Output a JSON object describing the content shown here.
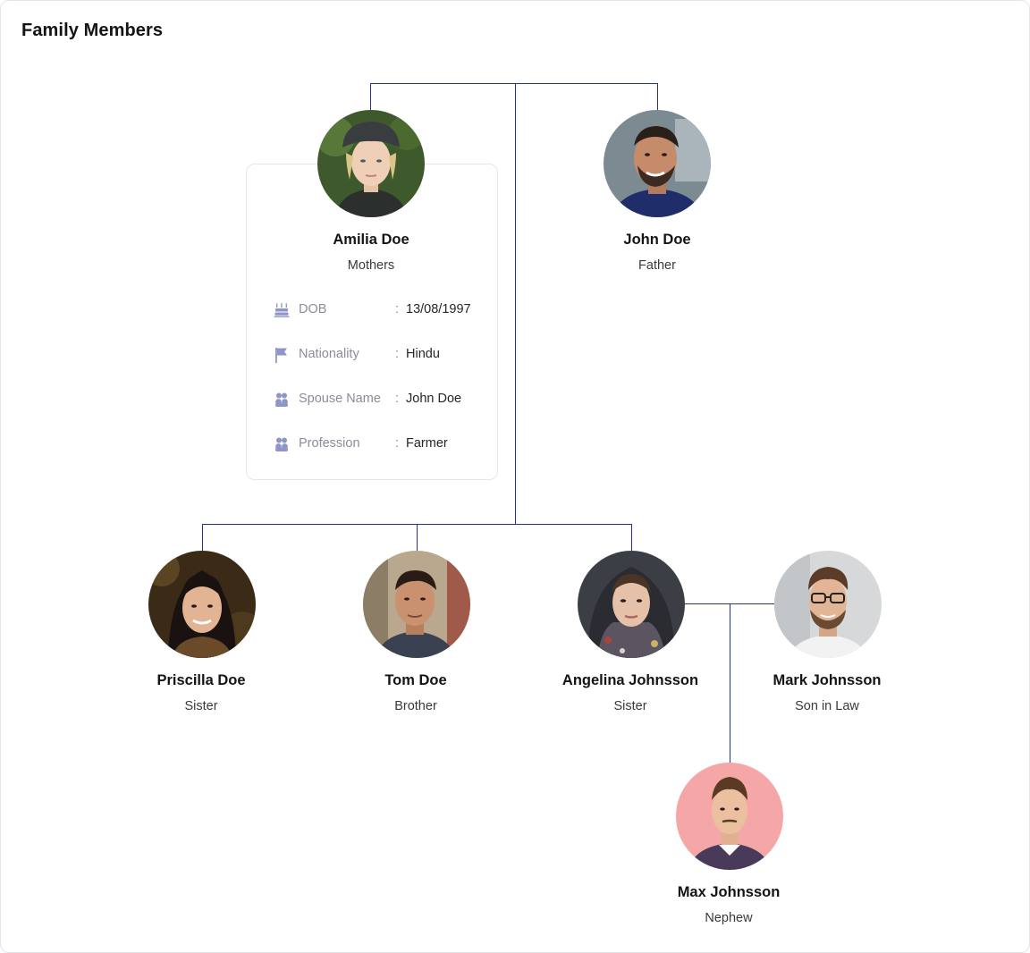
{
  "page": {
    "title": "Family Members"
  },
  "colors": {
    "line": "#2d3280",
    "icon": "#8f95c6",
    "border": "#e4e4ea"
  },
  "members": {
    "amilia": {
      "name": "Amilia Doe",
      "relation": "Mothers"
    },
    "john": {
      "name": "John Doe",
      "relation": "Father"
    },
    "priscilla": {
      "name": "Priscilla Doe",
      "relation": "Sister"
    },
    "tom": {
      "name": "Tom Doe",
      "relation": "Brother"
    },
    "angelina": {
      "name": "Angelina Johnsson",
      "relation": "Sister"
    },
    "mark": {
      "name": "Mark Johnsson",
      "relation": "Son in Law"
    },
    "max": {
      "name": "Max Johnsson",
      "relation": "Nephew"
    }
  },
  "details": {
    "dob": {
      "icon": "cake-icon",
      "label": "DOB",
      "value": "13/08/1997"
    },
    "nationality": {
      "icon": "flag-icon",
      "label": "Nationality",
      "value": "Hindu"
    },
    "spouse": {
      "icon": "people-icon",
      "label": "Spouse Name",
      "value": "John Doe"
    },
    "profession": {
      "icon": "people-icon",
      "label": "Profession",
      "value": "Farmer"
    }
  },
  "separator": ":"
}
